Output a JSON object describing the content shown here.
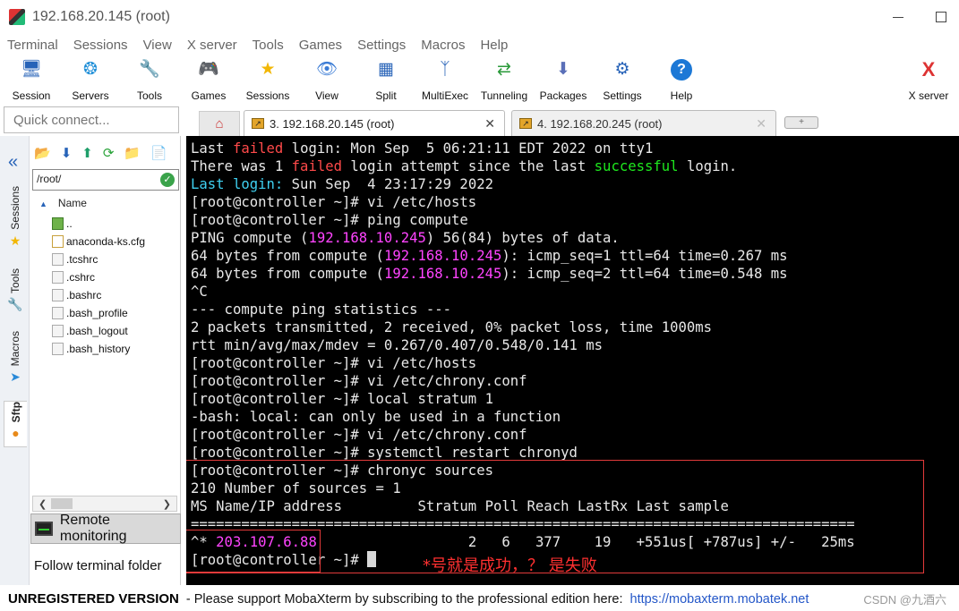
{
  "window": {
    "title": "192.168.20.145 (root)"
  },
  "menu": [
    "Terminal",
    "Sessions",
    "View",
    "X server",
    "Tools",
    "Games",
    "Settings",
    "Macros",
    "Help"
  ],
  "toolbar": [
    {
      "label": "Session",
      "icon": "session-icon"
    },
    {
      "label": "Servers",
      "icon": "servers-icon"
    },
    {
      "label": "Tools",
      "icon": "tools-icon"
    },
    {
      "label": "Games",
      "icon": "games-icon"
    },
    {
      "label": "Sessions",
      "icon": "sessions-star-icon"
    },
    {
      "label": "View",
      "icon": "view-icon"
    },
    {
      "label": "Split",
      "icon": "split-icon"
    },
    {
      "label": "MultiExec",
      "icon": "multiexec-icon"
    },
    {
      "label": "Tunneling",
      "icon": "tunneling-icon"
    },
    {
      "label": "Packages",
      "icon": "packages-icon"
    },
    {
      "label": "Settings",
      "icon": "settings-icon"
    },
    {
      "label": "Help",
      "icon": "help-icon"
    },
    {
      "label": "X server",
      "icon": "xserver-icon"
    }
  ],
  "quick_connect": {
    "placeholder": "Quick connect..."
  },
  "tabs": [
    {
      "label": "3. 192.168.20.145 (root)",
      "active": true
    },
    {
      "label": "4. 192.168.20.245 (root)",
      "active": false
    }
  ],
  "side_tabs": [
    "Sessions",
    "Tools",
    "Macros",
    "Sftp"
  ],
  "sftp": {
    "path": "/root/",
    "column": "Name",
    "files": [
      "..",
      "anaconda-ks.cfg",
      ".tcshrc",
      ".cshrc",
      ".bashrc",
      ".bash_profile",
      ".bash_logout",
      ".bash_history"
    ],
    "remote_monitoring": "Remote monitoring",
    "follow_folder": "Follow terminal folder"
  },
  "terminal": {
    "l1a": "Last ",
    "l1b": "failed",
    "l1c": " login: Mon Sep  5 06:21:11 EDT 2022 on tty1",
    "l2a": "There was 1 ",
    "l2b": "failed",
    "l2c": " login attempt since the last ",
    "l2d": "successful",
    "l2e": " login.",
    "l3a": "Last login:",
    "l3b": " Sun Sep  4 23:17:29 2022",
    "l4": "[root@controller ~]# vi /etc/hosts",
    "l5": "[root@controller ~]# ping compute",
    "l6a": "PING compute (",
    "l6b": "192.168.10.245",
    "l6c": ") 56(84) bytes of data.",
    "l7a": "64 bytes from compute (",
    "l7b": "192.168.10.245",
    "l7c": "): icmp_seq=1 ttl=64 time=0.267 ms",
    "l8a": "64 bytes from compute (",
    "l8b": "192.168.10.245",
    "l8c": "): icmp_seq=2 ttl=64 time=0.548 ms",
    "l9": "^C",
    "l10": "--- compute ping statistics ---",
    "l11": "2 packets transmitted, 2 received, 0% packet loss, time 1000ms",
    "l12": "rtt min/avg/max/mdev = 0.267/0.407/0.548/0.141 ms",
    "l13": "[root@controller ~]# vi /etc/hosts",
    "l14": "[root@controller ~]# vi /etc/chrony.conf",
    "l15": "[root@controller ~]# local stratum 1",
    "l16": "-bash: local: can only be used in a function",
    "l17": "[root@controller ~]# vi /etc/chrony.conf",
    "l18": "[root@controller ~]# systemctl restart chronyd",
    "l19": "[root@controller ~]# chronyc sources",
    "l20": "210 Number of sources = 1",
    "l21": "MS Name/IP address         Stratum Poll Reach LastRx Last sample",
    "l22": "===============================================================================",
    "l23a": "^* ",
    "l23b": "203.107.6.88",
    "l23c": "                  2   6   377    19   +551us[ +787us] +/-   25ms",
    "l24": "[root@controller ~]# "
  },
  "annotation": "*号就是成功，？ 是失败",
  "status": {
    "unregistered": "UNREGISTERED VERSION",
    "message": "-  Please support MobaXterm by subscribing to the professional edition here:",
    "link": "https://mobaxterm.mobatek.net",
    "watermark": "CSDN @九酒六"
  }
}
